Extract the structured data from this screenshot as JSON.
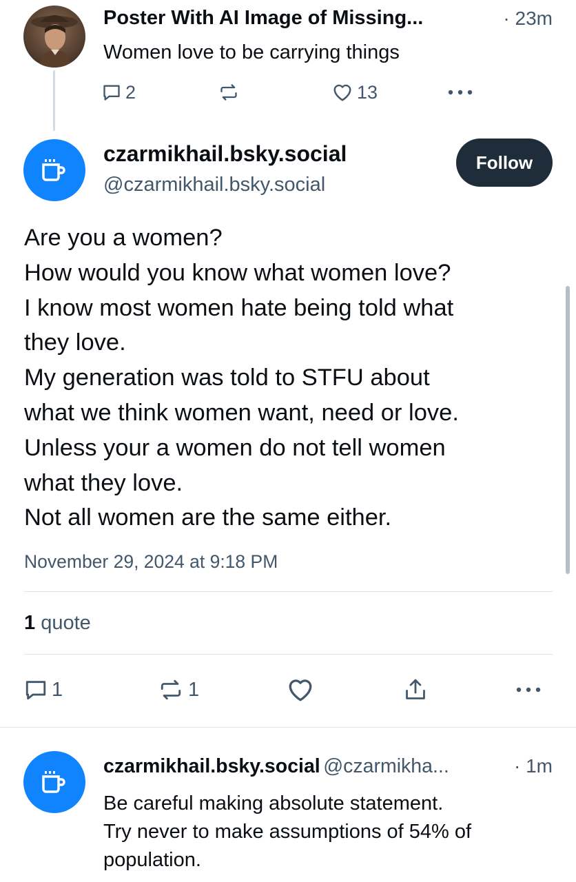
{
  "parent_post": {
    "author_name": "Poster With AI Image of Missing...",
    "time": "· 23m",
    "text": "Women love to be carrying things",
    "actions": {
      "replies": "2",
      "reposts": "",
      "likes": "13"
    },
    "icons": [
      "comment-icon",
      "repost-icon",
      "heart-icon",
      "more-icon"
    ]
  },
  "main_post": {
    "author_name": "czarmikhail.bsky.social",
    "author_handle": "@czarmikhail.bsky.social",
    "follow_label": "Follow",
    "body_lines": [
      "Are you a women?",
      "How would you know what women love?",
      "I know most women hate being told what",
      "they love.",
      "My generation was told to STFU about",
      "what we think women want, need or love.",
      "Unless your a women do not tell women",
      "what they love.",
      "Not all women are the same either."
    ],
    "timestamp": "November 29, 2024 at 9:18 PM",
    "quote_count": "1",
    "quote_label": "quote",
    "actions": {
      "replies": "1",
      "reposts": "1"
    },
    "icons": [
      "comment-icon",
      "repost-icon",
      "heart-icon",
      "share-icon",
      "more-icon"
    ]
  },
  "reply": {
    "author_name": "czarmikhail.bsky.social",
    "author_handle": "@czarmikha...",
    "time": "· 1m",
    "body_lines": [
      "Be careful making absolute statement.",
      "Try never to make assumptions of 54% of",
      "population."
    ]
  },
  "colors": {
    "avatar_blue": "#1083fe",
    "follow_button": "#1f2d3a",
    "muted_text": "#42576c",
    "divider": "#dfe4e9"
  }
}
